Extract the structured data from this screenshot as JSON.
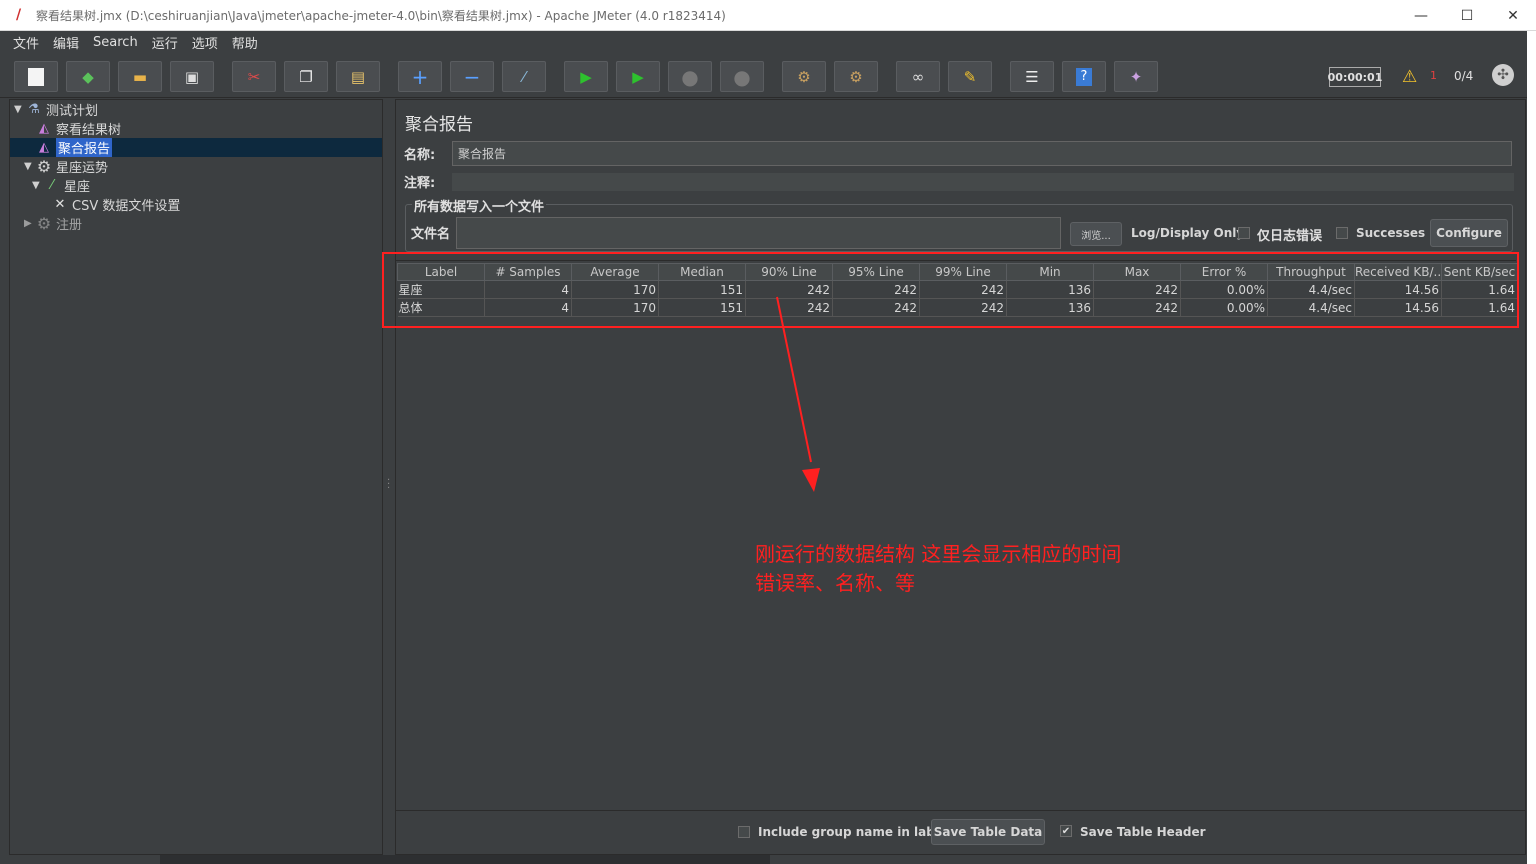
{
  "window": {
    "title": "察看结果树.jmx (D:\\ceshiruanjian\\Java\\jmeter\\apache-jmeter-4.0\\bin\\察看结果树.jmx) - Apache JMeter (4.0 r1823414)",
    "minimize": "—",
    "maximize": "☐",
    "close": "✕"
  },
  "menu": [
    "文件",
    "编辑",
    "Search",
    "运行",
    "选项",
    "帮助"
  ],
  "toolbar": {
    "icons": [
      "new-icon",
      "templates-icon",
      "open-icon",
      "save-icon",
      "cut-icon",
      "copy-icon",
      "paste-icon",
      "expand-icon",
      "collapse-icon",
      "toggle-icon",
      "start-icon",
      "start-no-pause-icon",
      "stop-icon",
      "shutdown-icon",
      "clear-icon",
      "clear-all-icon",
      "search-icon",
      "reset-search-icon",
      "function-helper-icon",
      "help-icon",
      "remote-icon"
    ],
    "timer": "00:00:01",
    "warning_count": "1",
    "threads": "0/4"
  },
  "tree": {
    "items": [
      {
        "label": "测试计划"
      },
      {
        "label": "察看结果树"
      },
      {
        "label": "聚合报告"
      },
      {
        "label": "星座运势"
      },
      {
        "label": "星座"
      },
      {
        "label": "CSV 数据文件设置"
      },
      {
        "label": "注册"
      }
    ]
  },
  "panel": {
    "title": "聚合报告",
    "name_label": "名称:",
    "name_value": "聚合报告",
    "comment_label": "注释:",
    "fileset_legend": "所有数据写入一个文件",
    "filename_label": "文件名",
    "browse": "浏览...",
    "log_display_only": "Log/Display Only:",
    "errors_only": "仅日志错误",
    "successes": "Successes",
    "configure": "Configure"
  },
  "table": {
    "headers": [
      "Label",
      "# Samples",
      "Average",
      "Median",
      "90% Line",
      "95% Line",
      "99% Line",
      "Min",
      "Max",
      "Error %",
      "Throughput",
      "Received KB/...",
      "Sent KB/sec"
    ],
    "rows": [
      [
        "星座",
        "4",
        "170",
        "151",
        "242",
        "242",
        "242",
        "136",
        "242",
        "0.00%",
        "4.4/sec",
        "14.56",
        "1.64"
      ],
      [
        "总体",
        "4",
        "170",
        "151",
        "242",
        "242",
        "242",
        "136",
        "242",
        "0.00%",
        "4.4/sec",
        "14.56",
        "1.64"
      ]
    ]
  },
  "annotation": {
    "line1": "刚运行的数据结构 这里会显示相应的时间",
    "line2": "错误率、名称、等",
    "color": "#ff2020"
  },
  "bottom": {
    "include_group": "Include group name in label?",
    "save_table_data": "Save Table Data",
    "save_table_header": "Save Table Header"
  }
}
